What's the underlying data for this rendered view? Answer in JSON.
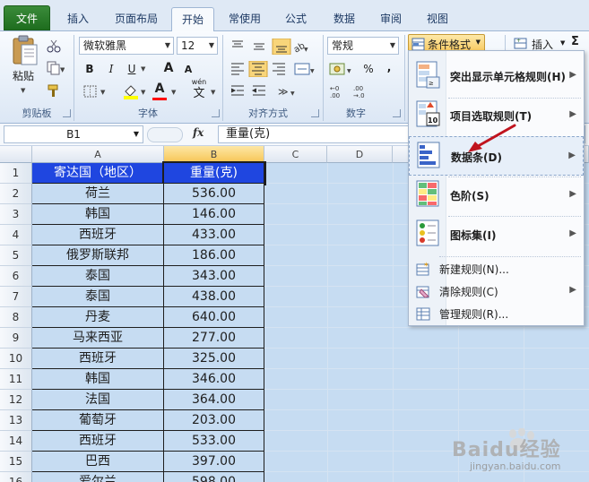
{
  "tabs": {
    "file": "文件",
    "items": [
      "插入",
      "页面布局",
      "开始",
      "常使用",
      "公式",
      "数据",
      "审阅",
      "视图"
    ],
    "active_index": 2
  },
  "ribbon": {
    "clipboard": {
      "paste": "粘贴",
      "label": "剪贴板"
    },
    "font": {
      "name": "微软雅黑",
      "size": "12",
      "bold": "B",
      "italic": "I",
      "underline": "U",
      "grow": "A",
      "shrink": "A",
      "color_a": "A",
      "wen": "wén",
      "label": "字体"
    },
    "alignment": {
      "label": "对齐方式"
    },
    "number": {
      "format": "常规",
      "percent": "%",
      "comma": ",",
      "label": "数字"
    },
    "styles": {
      "conditional_format": "条件格式"
    },
    "cells": {
      "insert": "插入"
    },
    "sigma": "Σ"
  },
  "formula_bar": {
    "name_box": "B1",
    "fx": "fx",
    "value": "重量(克)"
  },
  "grid": {
    "columns": [
      "A",
      "B",
      "C",
      "D"
    ],
    "rows": [
      {
        "num": "1",
        "a": "寄达国（地区）",
        "b": "重量(克)"
      },
      {
        "num": "2",
        "a": "荷兰",
        "b": "536.00"
      },
      {
        "num": "3",
        "a": "韩国",
        "b": "146.00"
      },
      {
        "num": "4",
        "a": "西班牙",
        "b": "433.00"
      },
      {
        "num": "5",
        "a": "俄罗斯联邦",
        "b": "186.00"
      },
      {
        "num": "6",
        "a": "泰国",
        "b": "343.00"
      },
      {
        "num": "7",
        "a": "泰国",
        "b": "438.00"
      },
      {
        "num": "8",
        "a": "丹麦",
        "b": "640.00"
      },
      {
        "num": "9",
        "a": "马来西亚",
        "b": "277.00"
      },
      {
        "num": "10",
        "a": "西班牙",
        "b": "325.00"
      },
      {
        "num": "11",
        "a": "韩国",
        "b": "346.00"
      },
      {
        "num": "12",
        "a": "法国",
        "b": "364.00"
      },
      {
        "num": "13",
        "a": "葡萄牙",
        "b": "203.00"
      },
      {
        "num": "14",
        "a": "西班牙",
        "b": "533.00"
      },
      {
        "num": "15",
        "a": "巴西",
        "b": "397.00"
      },
      {
        "num": "16",
        "a": "爱尔兰",
        "b": "598.00"
      }
    ]
  },
  "menu": {
    "highlight_rules": "突出显示单元格规则(H)",
    "top_bottom": "项目选取规则(T)",
    "data_bars": "数据条(D)",
    "color_scales": "色阶(S)",
    "icon_sets": "图标集(I)",
    "new_rule": "新建规则(N)...",
    "clear_rules": "清除规则(C)",
    "manage_rules": "管理规则(R)..."
  },
  "watermark": {
    "brand": "Baidu经验",
    "url": "jingyan.baidu.com"
  },
  "colors": {
    "header_fill": "#1f46e0",
    "selection_fill": "#c6dcf2",
    "file_tab": "#2a7d2a",
    "arrow": "#c0141e"
  }
}
